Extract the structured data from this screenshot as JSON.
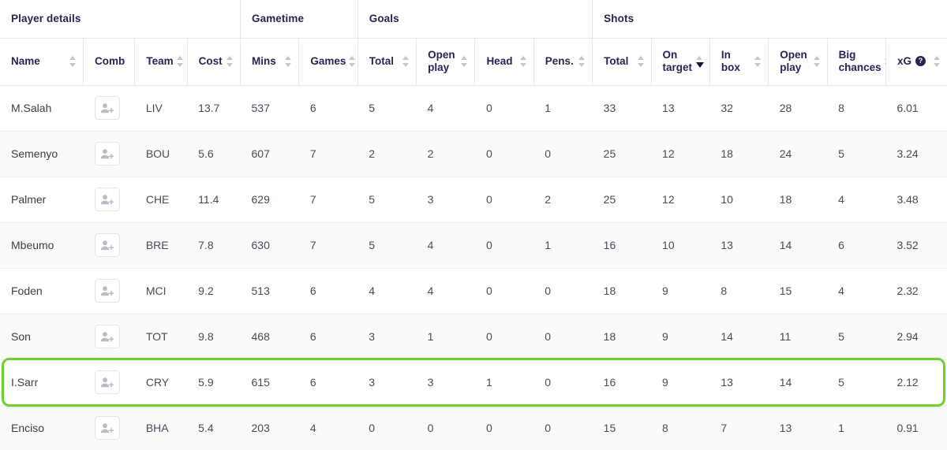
{
  "table": {
    "group_headers": [
      {
        "label": "Player details",
        "span": 4
      },
      {
        "label": "Gametime",
        "span": 2
      },
      {
        "label": "Goals",
        "span": 4
      },
      {
        "label": "Shots",
        "span": 6
      }
    ],
    "columns": [
      {
        "label": "Name",
        "sortable": true,
        "sorted": "none"
      },
      {
        "label": "Comb",
        "sortable": false,
        "sorted": "none"
      },
      {
        "label": "Team",
        "sortable": true,
        "sorted": "none"
      },
      {
        "label": "Cost",
        "sortable": true,
        "sorted": "none"
      },
      {
        "label": "Mins",
        "sortable": true,
        "sorted": "none"
      },
      {
        "label": "Games",
        "sortable": true,
        "sorted": "none"
      },
      {
        "label": "Total",
        "sortable": true,
        "sorted": "none"
      },
      {
        "label": "Open\nplay",
        "sortable": true,
        "sorted": "none"
      },
      {
        "label": "Head",
        "sortable": true,
        "sorted": "none"
      },
      {
        "label": "Pens.",
        "sortable": true,
        "sorted": "none"
      },
      {
        "label": "Total",
        "sortable": true,
        "sorted": "none"
      },
      {
        "label": "On\ntarget",
        "sortable": true,
        "sorted": "desc"
      },
      {
        "label": "In box",
        "sortable": true,
        "sorted": "none"
      },
      {
        "label": "Open\nplay",
        "sortable": true,
        "sorted": "none"
      },
      {
        "label": "Big\nchances",
        "sortable": true,
        "sorted": "none"
      },
      {
        "label": "xG",
        "sortable": true,
        "sorted": "none",
        "info": "?"
      }
    ],
    "add_to_comb_label": "add-to-combination",
    "rows": [
      {
        "name": "M.Salah",
        "team": "LIV",
        "cost": "13.7",
        "mins": "537",
        "games": "6",
        "goals_total": "5",
        "goals_open_play": "4",
        "goals_head": "0",
        "goals_pens": "1",
        "shots_total": "33",
        "shots_on_target": "13",
        "shots_in_box": "32",
        "shots_open_play": "28",
        "big_chances": "8",
        "xg": "6.01",
        "highlighted": false
      },
      {
        "name": "Semenyo",
        "team": "BOU",
        "cost": "5.6",
        "mins": "607",
        "games": "7",
        "goals_total": "2",
        "goals_open_play": "2",
        "goals_head": "0",
        "goals_pens": "0",
        "shots_total": "25",
        "shots_on_target": "12",
        "shots_in_box": "18",
        "shots_open_play": "24",
        "big_chances": "5",
        "xg": "3.24",
        "highlighted": false
      },
      {
        "name": "Palmer",
        "team": "CHE",
        "cost": "11.4",
        "mins": "629",
        "games": "7",
        "goals_total": "5",
        "goals_open_play": "3",
        "goals_head": "0",
        "goals_pens": "2",
        "shots_total": "25",
        "shots_on_target": "12",
        "shots_in_box": "10",
        "shots_open_play": "18",
        "big_chances": "4",
        "xg": "3.48",
        "highlighted": false
      },
      {
        "name": "Mbeumo",
        "team": "BRE",
        "cost": "7.8",
        "mins": "630",
        "games": "7",
        "goals_total": "5",
        "goals_open_play": "4",
        "goals_head": "0",
        "goals_pens": "1",
        "shots_total": "16",
        "shots_on_target": "10",
        "shots_in_box": "13",
        "shots_open_play": "14",
        "big_chances": "6",
        "xg": "3.52",
        "highlighted": false
      },
      {
        "name": "Foden",
        "team": "MCI",
        "cost": "9.2",
        "mins": "513",
        "games": "6",
        "goals_total": "4",
        "goals_open_play": "4",
        "goals_head": "0",
        "goals_pens": "0",
        "shots_total": "18",
        "shots_on_target": "9",
        "shots_in_box": "8",
        "shots_open_play": "15",
        "big_chances": "4",
        "xg": "2.32",
        "highlighted": false
      },
      {
        "name": "Son",
        "team": "TOT",
        "cost": "9.8",
        "mins": "468",
        "games": "6",
        "goals_total": "3",
        "goals_open_play": "1",
        "goals_head": "0",
        "goals_pens": "0",
        "shots_total": "18",
        "shots_on_target": "9",
        "shots_in_box": "14",
        "shots_open_play": "11",
        "big_chances": "5",
        "xg": "2.94",
        "highlighted": false
      },
      {
        "name": "I.Sarr",
        "team": "CRY",
        "cost": "5.9",
        "mins": "615",
        "games": "6",
        "goals_total": "3",
        "goals_open_play": "3",
        "goals_head": "1",
        "goals_pens": "0",
        "shots_total": "16",
        "shots_on_target": "9",
        "shots_in_box": "13",
        "shots_open_play": "14",
        "big_chances": "5",
        "xg": "2.12",
        "highlighted": true
      },
      {
        "name": "Enciso",
        "team": "BHA",
        "cost": "5.4",
        "mins": "203",
        "games": "4",
        "goals_total": "0",
        "goals_open_play": "0",
        "goals_head": "0",
        "goals_pens": "0",
        "shots_total": "15",
        "shots_on_target": "8",
        "shots_in_box": "7",
        "shots_open_play": "13",
        "big_chances": "1",
        "xg": "0.91",
        "highlighted": false
      }
    ]
  },
  "colors": {
    "highlight_green": "#6fd12c",
    "header_text": "#2d1f52",
    "body_text": "#4a4a58",
    "alt_row": "#fafafa",
    "border": "#e9e9ed"
  }
}
